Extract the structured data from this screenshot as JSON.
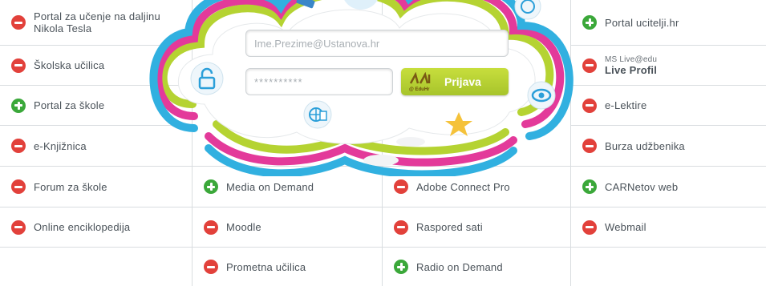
{
  "links": {
    "c1": [
      {
        "label": "Portal za učenje na daljinu Nikola Tesla",
        "status": "remove"
      },
      {
        "label": "Školska učilica",
        "status": "remove"
      },
      {
        "label": "Portal za škole",
        "status": "add"
      },
      {
        "label": "e-Knjižnica",
        "status": "remove"
      },
      {
        "label": "Forum za škole",
        "status": "remove"
      },
      {
        "label": "Online enciklopedija",
        "status": "remove"
      }
    ],
    "c2": [
      {
        "label": "Media on Demand",
        "status": "add"
      },
      {
        "label": "Moodle",
        "status": "remove"
      },
      {
        "label": "Prometna učilica",
        "status": "remove"
      }
    ],
    "c3": [
      {
        "label": "Adobe Connect Pro",
        "status": "remove"
      },
      {
        "label": "Raspored sati",
        "status": "remove"
      },
      {
        "label": "Radio on Demand",
        "status": "add"
      }
    ],
    "c4": [
      {
        "label": "Portal ucitelji.hr",
        "status": "add"
      },
      {
        "label_small": "MS Live@edu",
        "label": "Live Profil",
        "status": "remove"
      },
      {
        "label": "e-Lektire",
        "status": "remove"
      },
      {
        "label": "Burza udžbenika",
        "status": "remove"
      },
      {
        "label": "CARNetov web",
        "status": "add"
      },
      {
        "label": "Webmail",
        "status": "remove"
      }
    ]
  },
  "login": {
    "username_placeholder": "Ime.Prezime@Ustanova.hr",
    "password_value": "**********",
    "button_label": "Prijava",
    "logo_sub": "@ EduHr"
  },
  "colors": {
    "remove": "#e2413b",
    "add": "#3ba83a",
    "accent": "#b5d332"
  }
}
